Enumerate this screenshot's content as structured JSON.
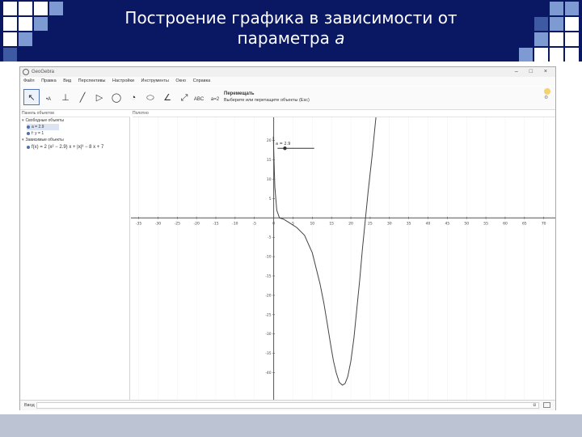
{
  "slide": {
    "title_line1": "Построение графика в зависимости от",
    "title_line2_prefix": "параметра ",
    "title_param": "а",
    "header_color": "#0a1864"
  },
  "app": {
    "title": "GeoGebra",
    "window_buttons": "–  □  ×",
    "menu": [
      "Файл",
      "Правка",
      "Вид",
      "Перспективы",
      "Настройки",
      "Инструменты",
      "Окно",
      "Справка"
    ],
    "tools": [
      {
        "icon": "move-tool-icon",
        "glyph": "↖",
        "active": true
      },
      {
        "icon": "point-tool-icon",
        "glyph": "•A"
      },
      {
        "icon": "perpendicular-tool-icon",
        "glyph": "⊥"
      },
      {
        "icon": "line-tool-icon",
        "glyph": "╱"
      },
      {
        "icon": "polygon-tool-icon",
        "glyph": "▷"
      },
      {
        "icon": "circle-tool-icon",
        "glyph": "◯"
      },
      {
        "icon": "circle-arc-tool-icon",
        "glyph": "◔"
      },
      {
        "icon": "conic-tool-icon",
        "glyph": "⬭"
      },
      {
        "icon": "angle-tool-icon",
        "glyph": "∠"
      },
      {
        "icon": "reflect-tool-icon",
        "glyph": "⤢"
      },
      {
        "icon": "text-tool-icon",
        "glyph": "ABC"
      },
      {
        "icon": "slider-tool-icon",
        "glyph": "a=2"
      },
      {
        "icon": "move-view-tool-icon",
        "glyph": "✥"
      }
    ],
    "tool_info": {
      "name": "Перемещать",
      "hint": "Выберите или перетащите объекты (Esc)"
    },
    "algebra": {
      "header": "Панель объектов",
      "sections": [
        {
          "label": "Свободные объекты"
        },
        {
          "label": "a = 2.9",
          "item": true,
          "selected": true
        },
        {
          "label": "f: y = 1",
          "item": true
        },
        {
          "label": "Зависимые объекты"
        },
        {
          "label": "f(x) = 2 (x² − 2.9) x + |x|³ − 8 x + 7",
          "item": true
        }
      ]
    },
    "graphics": {
      "header": "Полотно",
      "slider_label": "a = 2.9",
      "x_ticks": [
        "-35",
        "-30",
        "-25",
        "-20",
        "-15",
        "-10",
        "-5",
        "0",
        "5",
        "10",
        "15",
        "20",
        "25",
        "30",
        "35",
        "40",
        "45",
        "50",
        "55",
        "60",
        "65",
        "70"
      ],
      "y_ticks": [
        "20",
        "15",
        "10",
        "5",
        "-5",
        "-10",
        "-15",
        "-20",
        "-25",
        "-30",
        "-35",
        "-40"
      ]
    },
    "input_bar": {
      "label": "Ввод",
      "placeholder": "",
      "symbol": "α"
    }
  },
  "curve": {
    "x": [
      -0.1,
      0.3,
      0.8,
      1.5,
      2.5,
      4,
      6,
      8,
      10,
      12,
      13,
      14,
      14.8,
      15.5,
      16.2,
      17,
      17.8,
      18.5,
      19.2,
      20,
      20.8,
      21.5,
      22.3,
      23,
      23.8,
      24.5,
      25.5,
      26.5,
      27.5,
      28.5,
      29.5,
      30.2
    ],
    "y": [
      21,
      8,
      2,
      0,
      -0.3,
      -1.2,
      -2.5,
      -4.5,
      -9,
      -17,
      -22,
      -28,
      -33,
      -37,
      -40,
      -42.5,
      -43.2,
      -42.8,
      -41,
      -37,
      -31,
      -24,
      -16,
      -8,
      0,
      7,
      16,
      26,
      38,
      50,
      62,
      72
    ]
  }
}
